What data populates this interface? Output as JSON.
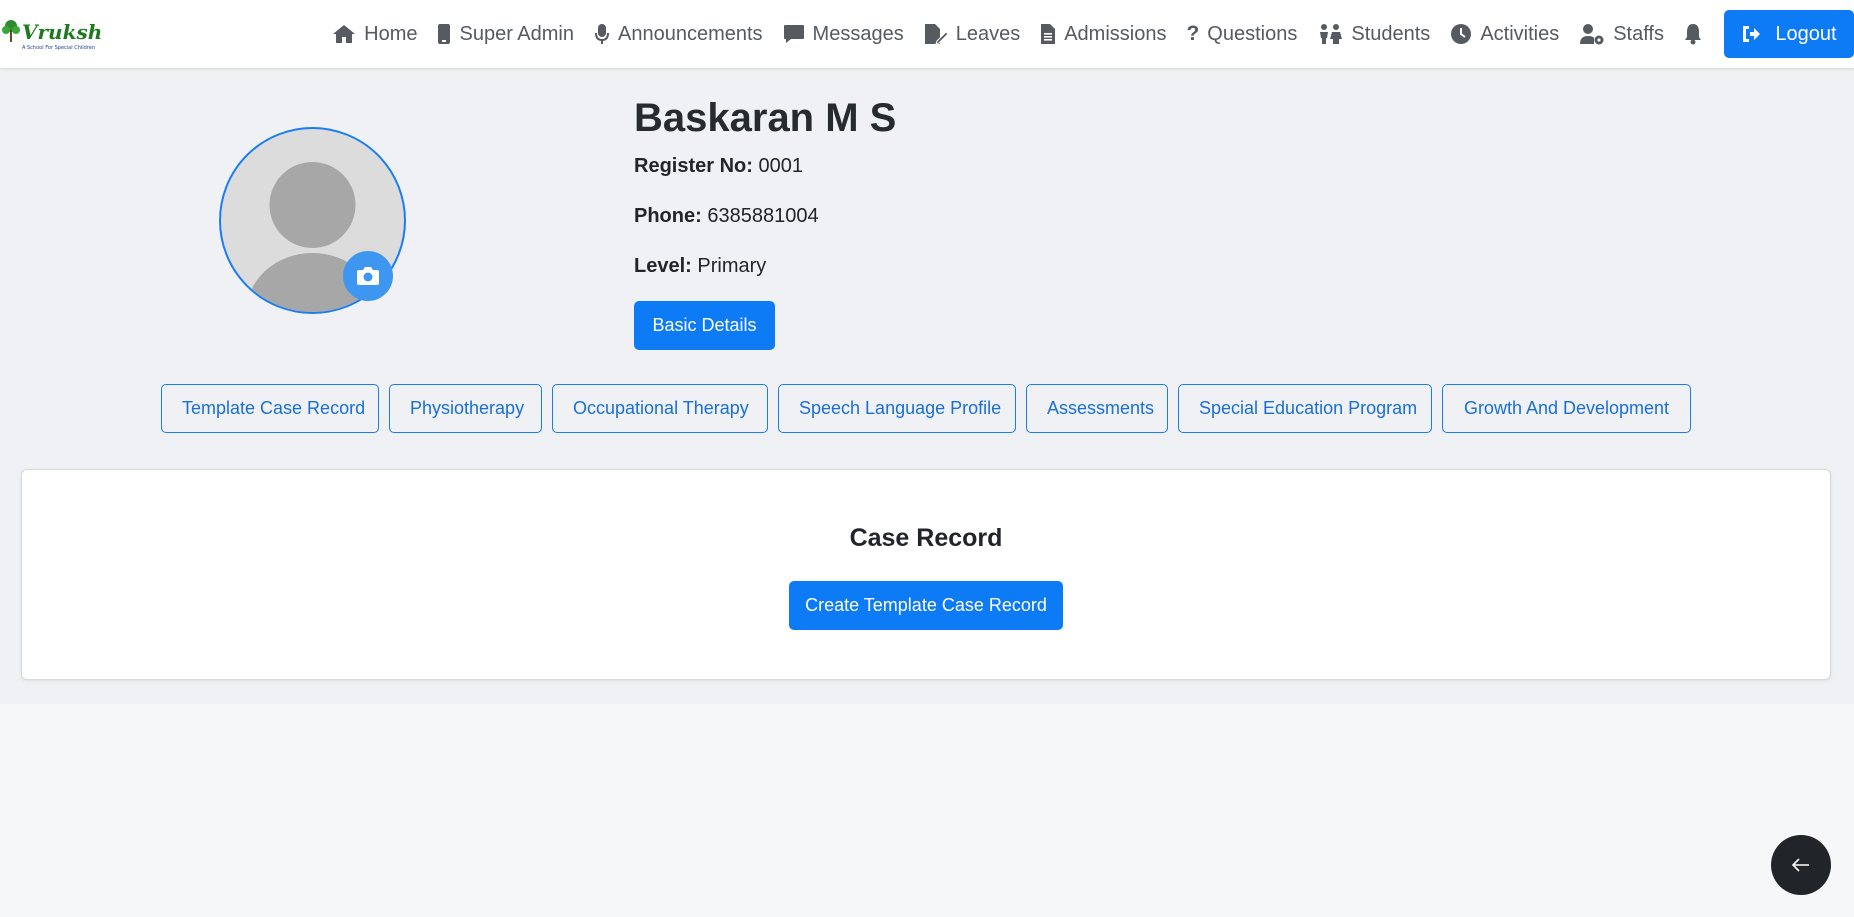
{
  "brand": {
    "logo_text": "Vruksh",
    "logo_tagline": "A School For Special Children"
  },
  "nav": {
    "items": [
      {
        "label": "Home",
        "icon": "home-icon"
      },
      {
        "label": "Super Admin",
        "icon": "mobile-icon"
      },
      {
        "label": "Announcements",
        "icon": "microphone-icon"
      },
      {
        "label": "Messages",
        "icon": "message-icon"
      },
      {
        "label": "Leaves",
        "icon": "file-edit-icon"
      },
      {
        "label": "Admissions",
        "icon": "file-text-icon"
      },
      {
        "label": "Questions",
        "icon": "question-icon"
      },
      {
        "label": "Students",
        "icon": "children-icon"
      },
      {
        "label": "Activities",
        "icon": "clock-icon"
      },
      {
        "label": "Staffs",
        "icon": "user-gear-icon"
      }
    ],
    "notifications_icon": "bell-icon",
    "logout_label": "Logout"
  },
  "profile": {
    "name": "Baskaran M S",
    "register_label": "Register No:",
    "register_value": "0001",
    "phone_label": "Phone:",
    "phone_value": "6385881004",
    "level_label": "Level:",
    "level_value": "Primary",
    "basic_details_label": "Basic Details"
  },
  "tabs": [
    "Template Case Record",
    "Physiotherapy",
    "Occupational Therapy",
    "Speech Language Profile",
    "Assessments",
    "Special Education Program",
    "Growth And Development"
  ],
  "case_record": {
    "title": "Case Record",
    "create_label": "Create Template Case Record"
  },
  "colors": {
    "primary": "#0d7bf5",
    "nav_text": "#555b61",
    "page_bg": "#eff1f5"
  }
}
